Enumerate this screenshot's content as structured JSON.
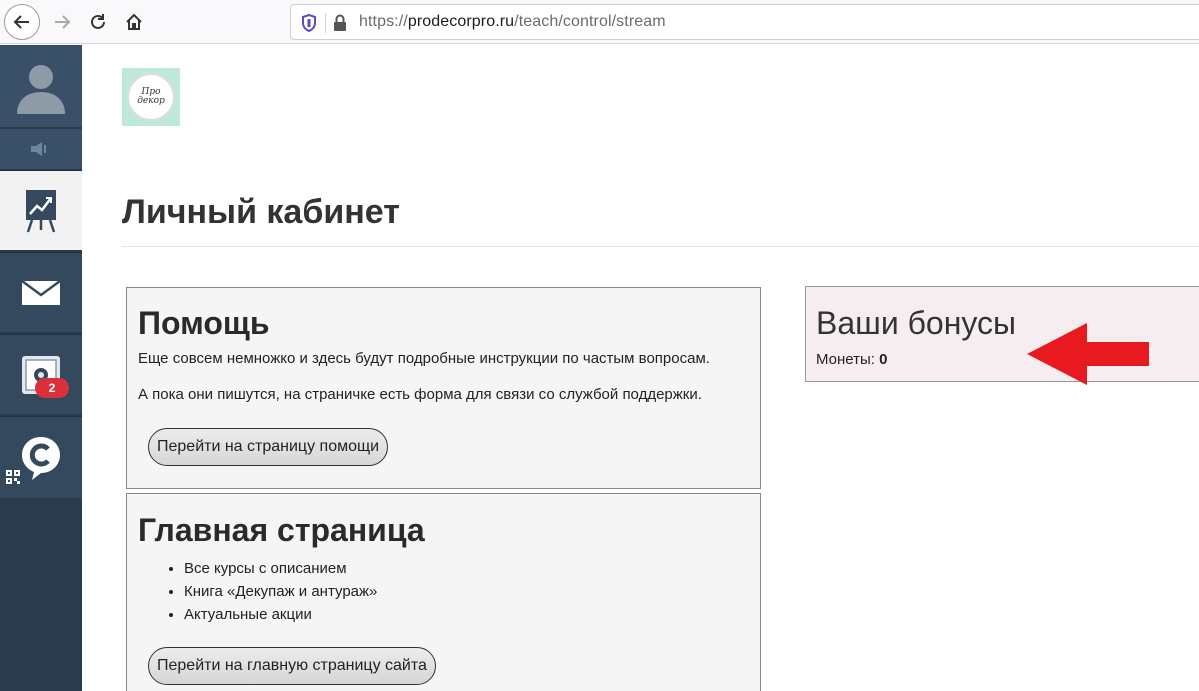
{
  "browser": {
    "url_prefix": "https://",
    "url_host": "prodecorpro.ru",
    "url_path": "/teach/control/stream"
  },
  "sidebar": {
    "badge_count": "2"
  },
  "logo": {
    "text": "Про декор"
  },
  "page": {
    "title": "Личный кабинет"
  },
  "help_card": {
    "title": "Помощь",
    "line1": "Еще совсем немножко и здесь будут подробные инструкции по частым вопросам.",
    "line2": "А пока они пишутся, на страничке есть форма для связи со службой поддержки.",
    "button": "Перейти на страницу помощи"
  },
  "main_card": {
    "title": "Главная страница",
    "items": [
      "Все курсы с описанием",
      "Книга «Декупаж и антураж»",
      "Актуальные акции"
    ],
    "button": "Перейти на главную страницу сайта"
  },
  "bonus": {
    "title": "Ваши бонусы",
    "coins_label": "Монеты:",
    "coins_value": "0"
  },
  "colors": {
    "sidebar": "#2b3b4d",
    "badge": "#d9303a",
    "arrow": "#e8191f",
    "bonus_bg": "#f6edf1"
  },
  "icons": [
    "back-icon",
    "forward-icon",
    "reload-icon",
    "home-icon",
    "shield-icon",
    "lock-icon",
    "user-avatar-icon",
    "sound-icon",
    "chart-board-icon",
    "mail-icon",
    "safe-icon",
    "chat-icon",
    "qr-icon"
  ]
}
